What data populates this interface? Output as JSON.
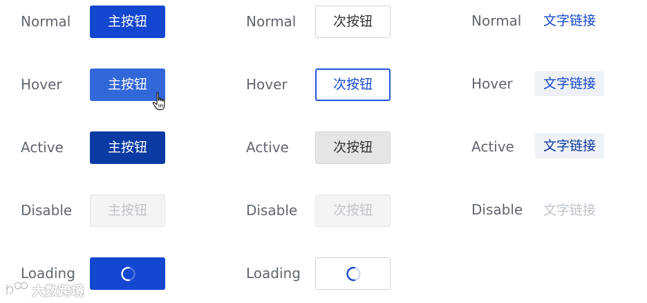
{
  "columns": {
    "primary": {
      "normal": {
        "state": "Normal",
        "label": "主按钮"
      },
      "hover": {
        "state": "Hover",
        "label": "主按钮"
      },
      "active": {
        "state": "Active",
        "label": "主按钮"
      },
      "disable": {
        "state": "Disable",
        "label": "主按钮"
      },
      "loading": {
        "state": "Loading",
        "label": ""
      }
    },
    "secondary": {
      "normal": {
        "state": "Normal",
        "label": "次按钮"
      },
      "hover": {
        "state": "Hover",
        "label": "次按钮"
      },
      "active": {
        "state": "Active",
        "label": "次按钮"
      },
      "disable": {
        "state": "Disable",
        "label": "次按钮"
      },
      "loading": {
        "state": "Loading",
        "label": ""
      }
    },
    "link": {
      "normal": {
        "state": "Normal",
        "label": "文字链接"
      },
      "hover": {
        "state": "Hover",
        "label": "文字链接"
      },
      "active": {
        "state": "Active",
        "label": "文字链接"
      },
      "disable": {
        "state": "Disable",
        "label": "文字链接"
      }
    }
  },
  "icons": {
    "cursor": "hand-pointer-icon",
    "spinner": "loading-spinner-icon",
    "watermark_logo": "watermark-logo-icon"
  },
  "watermark": {
    "text": "大数跨境"
  },
  "colors": {
    "primary": "#1447d0",
    "primary_hover": "#3267d9",
    "primary_active": "#0b3aa3",
    "disabled_bg": "#f3f4f6",
    "disabled_text": "#bfc3c9",
    "link_hover_bg": "#eef1f5",
    "label_text": "#5f6670"
  }
}
